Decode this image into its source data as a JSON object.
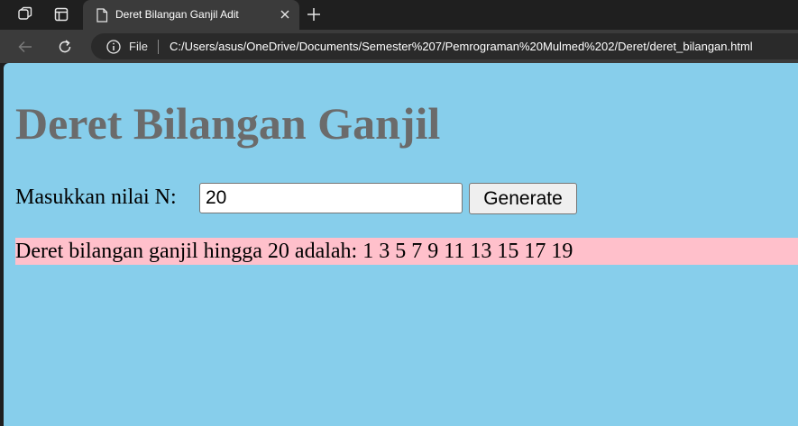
{
  "browser": {
    "tab_title": "Deret Bilangan Ganjil Adit",
    "address_scheme_label": "File",
    "url": "C:/Users/asus/OneDrive/Documents/Semester%207/Pemrograman%20Mulmed%202/Deret/deret_bilangan.html",
    "icons": [
      "workspaces-icon",
      "tab-actions-icon",
      "file-icon",
      "close-icon",
      "new-tab-icon",
      "back-icon",
      "refresh-icon",
      "info-icon"
    ]
  },
  "page": {
    "background_color": "#87ceeb",
    "title": "Deret Bilangan Ganjil",
    "input_label": "Masukkan nilai N:",
    "input_value": "20",
    "generate_label": "Generate",
    "result_text": "Deret bilangan ganjil hingga 20 adalah: 1 3 5 7 9 11 13 15 17 19",
    "result_background": "#ffc0cb"
  }
}
